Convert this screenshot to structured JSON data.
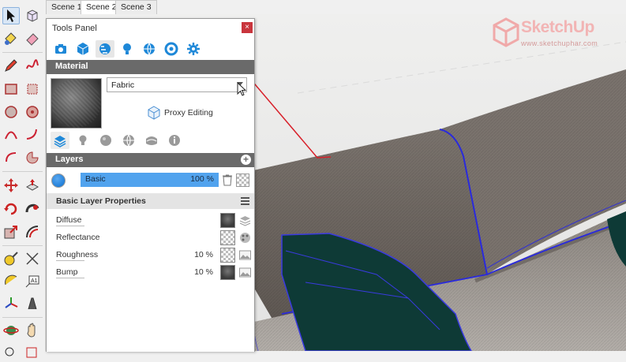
{
  "scene_tabs": [
    {
      "label": "Scene 1",
      "active": false
    },
    {
      "label": "Scene 2",
      "active": true
    },
    {
      "label": "Scene 3",
      "active": false
    }
  ],
  "toolbar": {
    "tools": [
      "select-icon",
      "make-component-icon",
      "paint-bucket-icon",
      "eraser-icon",
      "pencil-icon",
      "freehand-icon",
      "rectangle-icon",
      "rotated-rectangle-icon",
      "circle-icon",
      "polygon-icon",
      "arc-icon",
      "two-point-arc-icon",
      "three-point-arc-icon",
      "pie-icon",
      "move-icon",
      "push-pull-icon",
      "rotate-icon",
      "follow-me-icon",
      "scale-icon",
      "offset-icon",
      "tape-measure-icon",
      "dimension-icon",
      "protractor-icon",
      "text-icon",
      "axes-icon",
      "3d-text-icon",
      "orbit-icon",
      "pan-icon"
    ]
  },
  "logo": {
    "title": "SketchUp",
    "subtitle": "www.sketchuphar.com",
    "color": "#f2b4b4"
  },
  "tools_panel": {
    "title": "Tools Panel",
    "close_label": "×",
    "tab_icons": [
      "camera-icon",
      "cube-icon",
      "material-ball-icon",
      "light-bulb-icon",
      "environment-icon",
      "render-settings-icon",
      "gear-icon"
    ],
    "active_tab_index": 2
  },
  "material": {
    "header": "Material",
    "name": "Fabric",
    "proxy_label": "Proxy Editing",
    "sub_icons": [
      "layers-icon",
      "light-icon",
      "sphere-icon",
      "globe-icon",
      "texture-icon",
      "info-icon"
    ]
  },
  "layers": {
    "header": "Layers",
    "add_label": "+",
    "items": [
      {
        "name": "Basic",
        "opacity": "100 %"
      }
    ]
  },
  "layer_properties": {
    "header": "Basic Layer Properties",
    "rows": [
      {
        "label": "Diffuse",
        "value": ""
      },
      {
        "label": "Reflectance",
        "value": ""
      },
      {
        "label": "Roughness",
        "value": "10 %"
      },
      {
        "label": "Bump",
        "value": "10 %"
      }
    ]
  },
  "colors": {
    "accent_blue": "#51a3ee",
    "header_gray": "#6a6a6a",
    "close_red": "#c9353d",
    "selection_edge": "#2a2adc",
    "sofa": "#6f6862",
    "pillow": "#0e3a36"
  }
}
